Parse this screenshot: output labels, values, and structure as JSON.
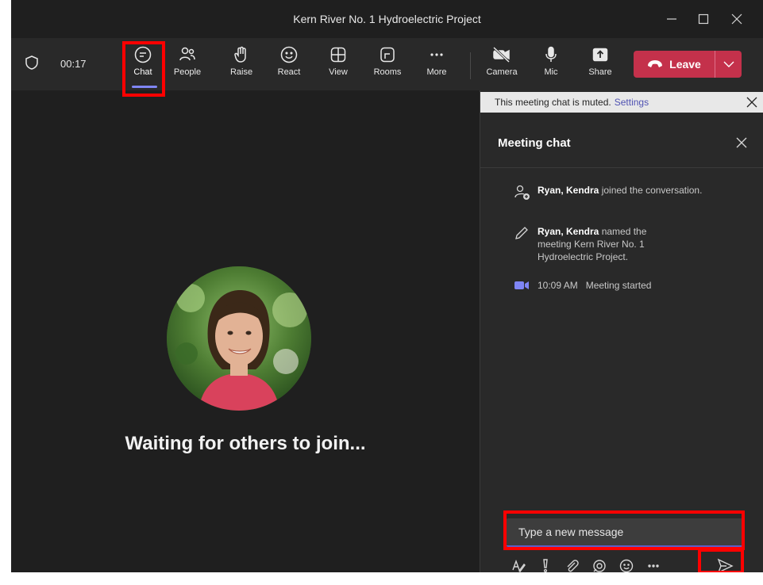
{
  "window": {
    "title": "Kern River No. 1 Hydroelectric Project",
    "controls": [
      "minimize-icon",
      "maximize-icon",
      "close-icon"
    ]
  },
  "toolbar": {
    "timer": "00:17",
    "buttons": [
      {
        "label": "Chat",
        "icon": "chat-icon",
        "active": true
      },
      {
        "label": "People",
        "icon": "people-icon"
      },
      {
        "label": "Raise",
        "icon": "hand-icon"
      },
      {
        "label": "React",
        "icon": "smile-icon"
      },
      {
        "label": "View",
        "icon": "grid-icon"
      },
      {
        "label": "Rooms",
        "icon": "rooms-icon"
      },
      {
        "label": "More",
        "icon": "more-icon"
      },
      {
        "label": "Camera",
        "icon": "camera-off-icon"
      },
      {
        "label": "Mic",
        "icon": "mic-icon"
      },
      {
        "label": "Share",
        "icon": "share-icon"
      }
    ],
    "leave_label": "Leave",
    "accent": "#7f85f5",
    "leave_color": "#c4314b"
  },
  "stage": {
    "waiting_text": "Waiting for others to join..."
  },
  "chat": {
    "banner_text": "This meeting chat is muted.",
    "banner_link": "Settings",
    "title": "Meeting chat",
    "events": [
      {
        "name": "Ryan, Kendra",
        "text": " joined the conversation.",
        "icon": "person-add-icon"
      },
      {
        "name": "Ryan, Kendra",
        "text": " named the meeting Kern River No. 1 Hydroelectric Project.",
        "icon": "pencil-icon"
      },
      {
        "time": "10:09 AM",
        "text": "Meeting started",
        "icon": "video-icon"
      }
    ],
    "compose_placeholder": "Type a new message",
    "compose_tools": [
      "format-icon",
      "important-icon",
      "attach-icon",
      "loop-icon",
      "emoji-icon",
      "more-icon"
    ]
  }
}
